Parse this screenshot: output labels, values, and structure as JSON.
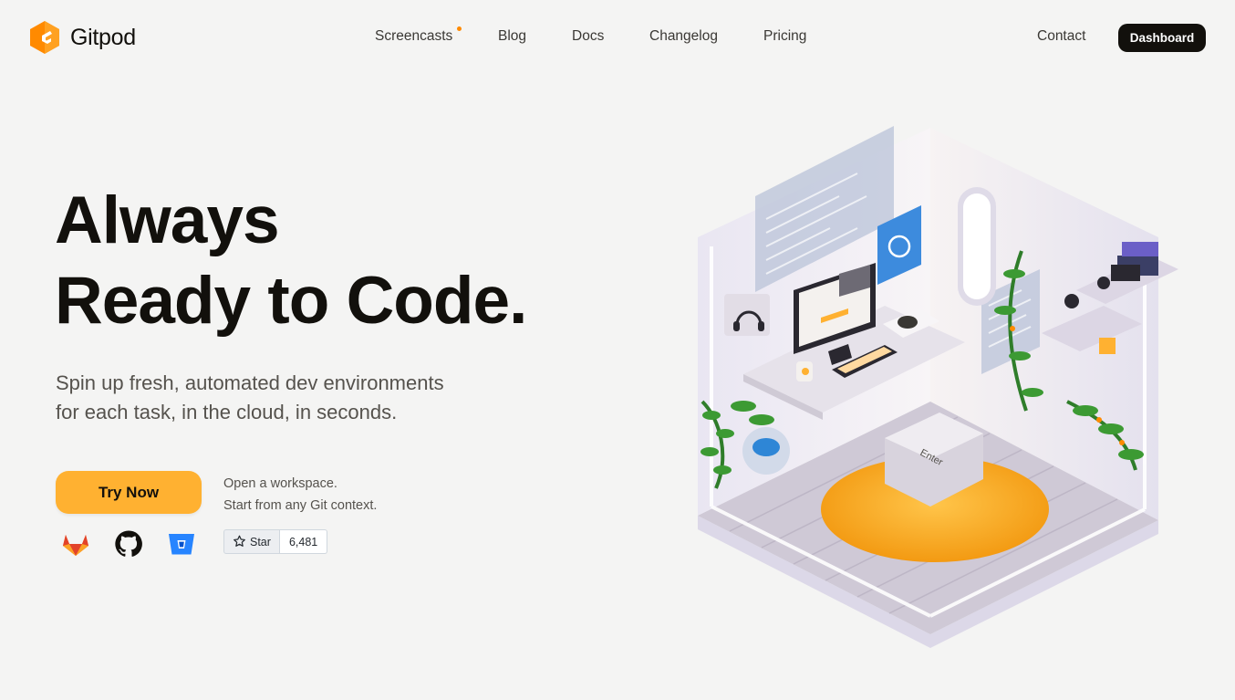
{
  "nav": {
    "brand": "Gitpod",
    "links": [
      "Screencasts",
      "Blog",
      "Docs",
      "Changelog",
      "Pricing"
    ],
    "contact": "Contact",
    "dashboard": "Dashboard"
  },
  "hero": {
    "title_line1": "Always",
    "title_line2": "Ready to Code.",
    "subtitle_line1": "Spin up fresh, automated dev environments",
    "subtitle_line2": "for each task, in the cloud, in seconds.",
    "cta": "Try Now",
    "note_line1": "Open a workspace.",
    "note_line2": "Start from any Git context.",
    "providers": [
      "gitlab-icon",
      "github-icon",
      "bitbucket-icon"
    ],
    "star_label": "Star",
    "star_count": "6,481"
  },
  "illustration": {
    "keycap_label": "Enter"
  },
  "colors": {
    "accent": "#ffb131",
    "brand_orange": "#ff8a00",
    "dark": "#12100c",
    "background": "#f4f4f3"
  }
}
